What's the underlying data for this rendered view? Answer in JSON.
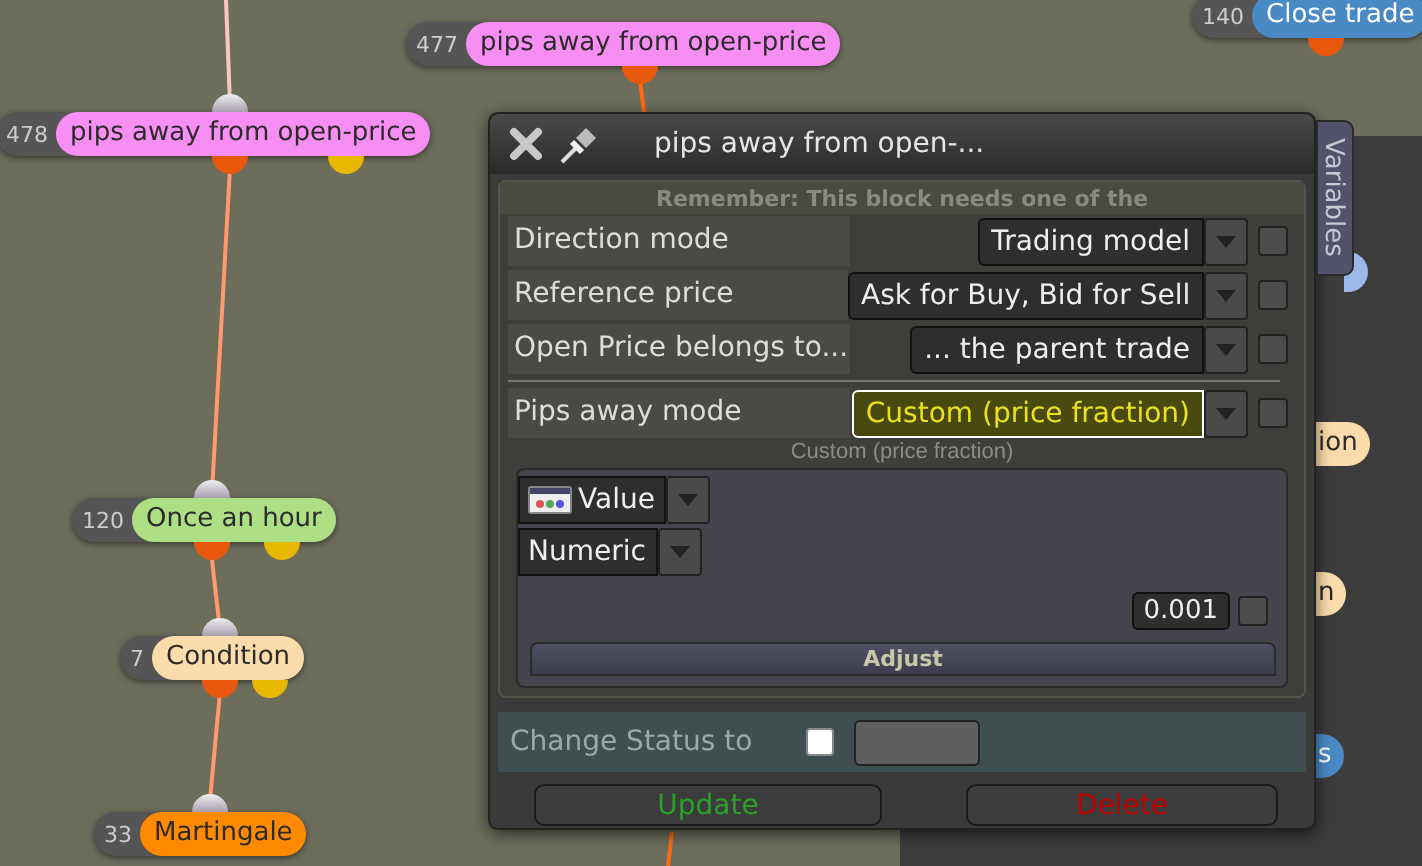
{
  "canvas": {
    "nodes": [
      {
        "number": "477",
        "label": "pips away from open-price",
        "color": "#f78ef3"
      },
      {
        "number": "478",
        "label": "pips away from open-price",
        "color": "#f78ef3"
      },
      {
        "number": "120",
        "label": "Once an hour",
        "color": "#addf84"
      },
      {
        "number": "7",
        "label": "Condition",
        "color": "#fddcab"
      },
      {
        "number": "33",
        "label": "Martingale",
        "color": "#ff8a00"
      },
      {
        "number": "140",
        "label": "Close trade",
        "color": "#4a8ac4"
      },
      {
        "label": "ion",
        "color": "#fddcab"
      },
      {
        "label": "n",
        "color": "#fddcab"
      },
      {
        "label": "s",
        "color": "#4a8ac4"
      }
    ]
  },
  "dialog": {
    "title": "pips away from open-...",
    "notice": "Remember: This block needs one of the",
    "fields": [
      {
        "label": "Direction mode",
        "value": "Trading model",
        "checked": false,
        "focused": false
      },
      {
        "label": "Reference price",
        "value": "Ask for Buy, Bid for Sell",
        "checked": false,
        "focused": false
      },
      {
        "label": "Open Price belongs to...",
        "value": "... the parent trade",
        "checked": false,
        "focused": false
      },
      {
        "label": "Pips away mode",
        "value": "Custom (price fraction)",
        "checked": false,
        "focused": true
      }
    ],
    "caption": "Custom (price fraction)",
    "value_panel": {
      "source": "Value",
      "type": "Numeric",
      "value": "0.001",
      "checked": false,
      "action": "Adjust"
    },
    "status": {
      "label": "Change Status to",
      "checked": false
    },
    "buttons": [
      {
        "label": "Update",
        "kind": "confirm"
      },
      {
        "label": "Delete",
        "kind": "danger"
      }
    ]
  },
  "side_tab": "Variables"
}
